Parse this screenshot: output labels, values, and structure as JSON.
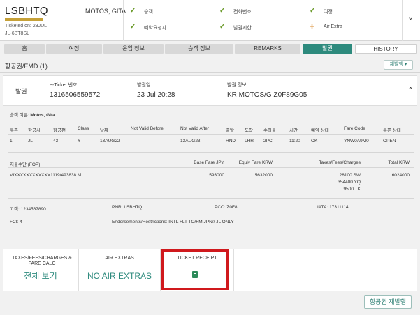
{
  "header": {
    "pnr": "LSBHTQ",
    "passenger": "MOTOS, GITA",
    "ticketed_on": "Ticketed on: 23JUL",
    "ref": "JL-6BT8SL",
    "progress": 1.0,
    "status_items": [
      {
        "label": "승객",
        "mark": "check"
      },
      {
        "label": "예약요청자",
        "mark": "check"
      },
      {
        "label": "전화번호",
        "mark": "check"
      },
      {
        "label": "발권시한",
        "mark": "check"
      },
      {
        "label": "여정",
        "mark": "check"
      },
      {
        "label": "Air Extra",
        "mark": "plus"
      }
    ],
    "expand_icon": "chevron-down-icon"
  },
  "tabs": [
    {
      "label": "홈"
    },
    {
      "label": "여정"
    },
    {
      "label": "운임 정보"
    },
    {
      "label": "승객 정보"
    },
    {
      "label": "REMARKS"
    },
    {
      "label": "발권",
      "active": true
    },
    {
      "label": "HISTORY"
    }
  ],
  "section": {
    "title": "항공권/EMD (1)",
    "reissue_small": "재발행 ▾"
  },
  "ticket": {
    "status": "발권",
    "eticket_label": "e-Ticket 번호:",
    "eticket_value": "1316506559572",
    "issue_date_label": "발권일:",
    "issue_date_value": "23 Jul 20:28",
    "issue_info_label": "발권 정보:",
    "issue_info_value": "KR MOTOS/G Z0F89G05",
    "collapse_icon": "chevron-up-icon"
  },
  "detail": {
    "passenger_name_label": "승객 이름:",
    "passenger_name": "Motos, Gita",
    "coupon_headers": [
      "쿠폰",
      "항공사",
      "항공편",
      "Class",
      "날짜",
      "Not Valid Before",
      "Not Valid After",
      "출발",
      "도착",
      "수하물",
      "시간",
      "예약 상태",
      "Fare Code",
      "쿠폰 상태"
    ],
    "coupon_rows": [
      [
        "1",
        "JL",
        "43",
        "Y",
        "13AUG22",
        "",
        "13AUG23",
        "HND",
        "LHR",
        "2PC",
        "11:20",
        "OK",
        "YNW0A9M0",
        "OPEN"
      ]
    ],
    "fare_headers": [
      "지불수단 (FOP)",
      "Base Fare JPY",
      "Equiv Fare KRW",
      "Taxes/Fees/Charges",
      "Total KRW"
    ],
    "fop": "VIXXXXXXXXXXXX1119/493838 M",
    "base_fare": "593000",
    "equiv_fare": "5632000",
    "taxes": [
      "28100 SW",
      "354400 YQ",
      "9500 TK"
    ],
    "total": "6024000",
    "customer_label": "고객:",
    "customer": "1234567890",
    "pnr_label": "PNR:",
    "pnr": "LSBHTQ",
    "pcc_label": "PCC:",
    "pcc": "Z0F8",
    "iata_label": "IATA:",
    "iata": "17311114",
    "fci_label": "FCI:",
    "fci": "4",
    "endorse_label": "Endorsements/Restrictions:",
    "endorse": "INTL FLT TO/FM JPN// JL ONLY"
  },
  "tiles": {
    "taxes_title": "TAXES/FEES/CHARGES & FARE CALC",
    "taxes_value": "전체 보기",
    "extras_title": "AIR EXTRAS",
    "extras_value": "NO AIR EXTRAS",
    "receipt_title": "TICKET RECEIPT",
    "receipt_icon": "document-icon"
  },
  "footer": {
    "reissue_button": "항공권 재발행"
  },
  "colors": {
    "accent": "#2d8a7d",
    "check": "#6a9a2a",
    "plus": "#d98a2b",
    "highlight": "#d0191d",
    "progress": "#c6a138"
  }
}
